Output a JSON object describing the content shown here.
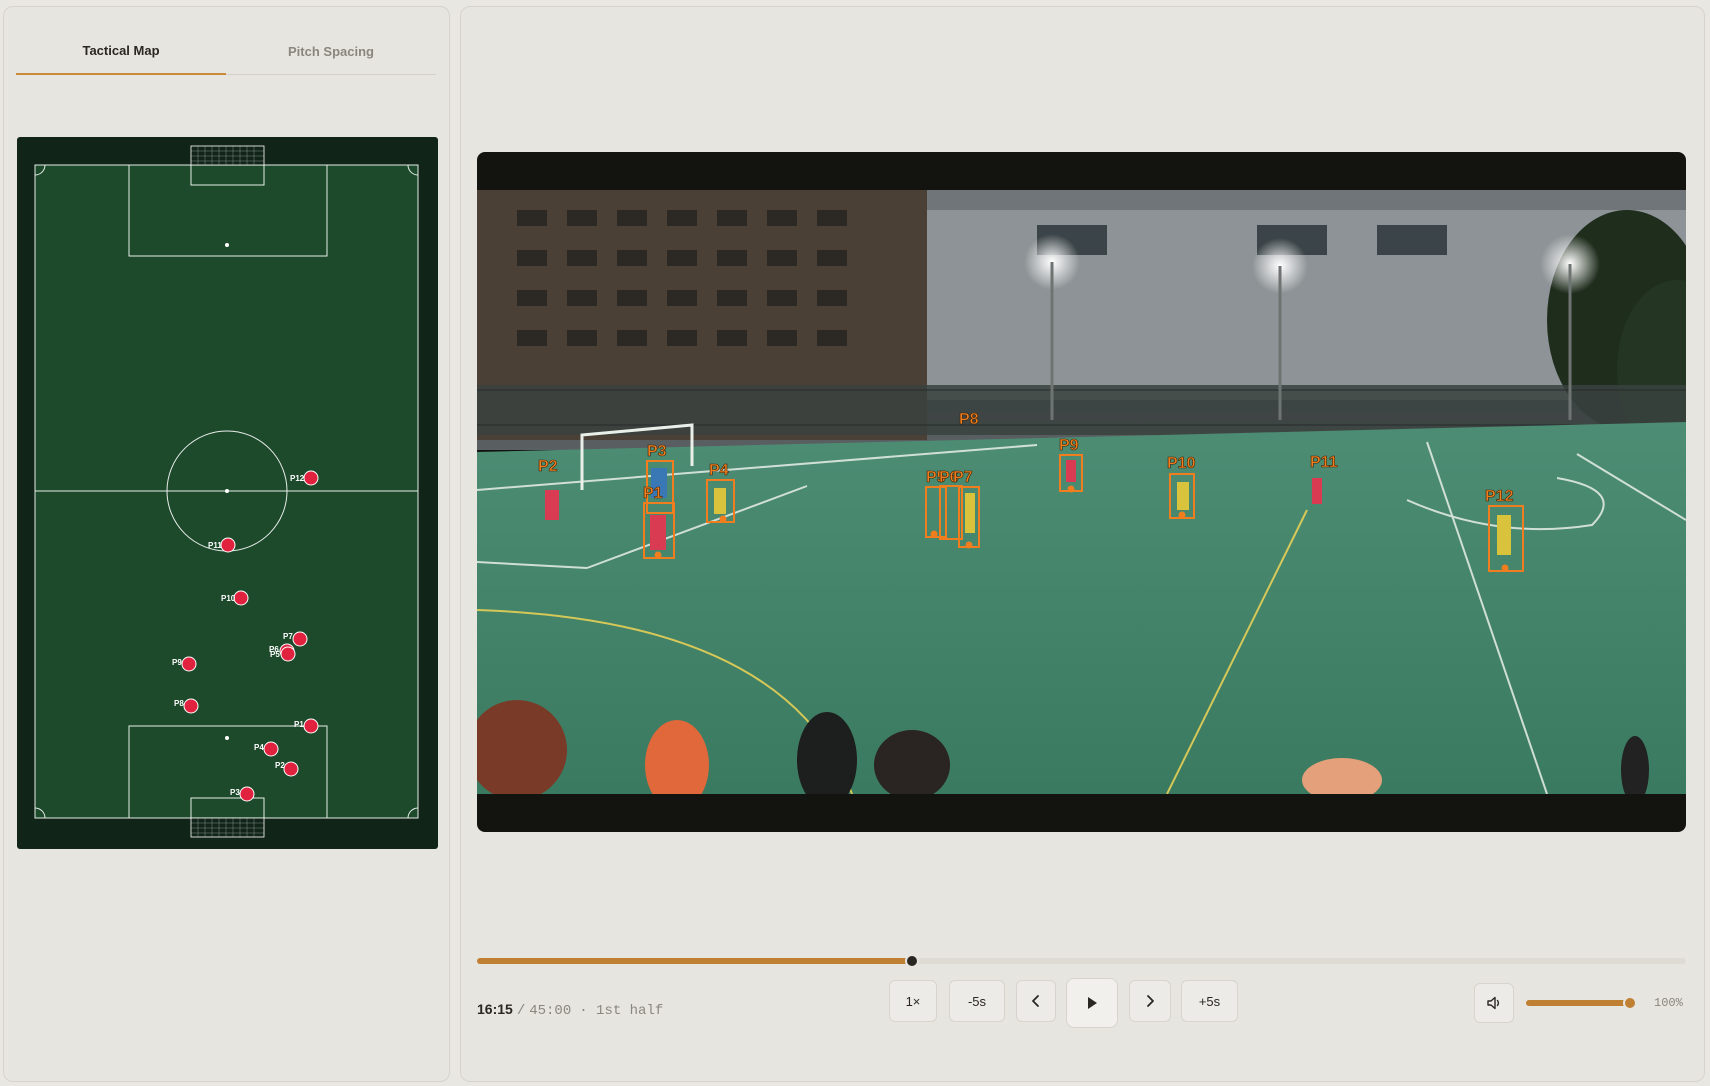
{
  "tabs": [
    {
      "label": "Tactical Map",
      "active": true
    },
    {
      "label": "Pitch Spacing",
      "active": false
    }
  ],
  "tactical_map": {
    "players": [
      {
        "id": "P12",
        "label": "P12"
      },
      {
        "id": "P11",
        "label": "P11"
      },
      {
        "id": "P10",
        "label": "P10"
      },
      {
        "id": "P7",
        "label": "P7"
      },
      {
        "id": "P6",
        "label": "P6"
      },
      {
        "id": "P5",
        "label": "P5"
      },
      {
        "id": "P9",
        "label": "P9"
      },
      {
        "id": "P8",
        "label": "P8"
      },
      {
        "id": "P1",
        "label": "P1"
      },
      {
        "id": "P4",
        "label": "P4"
      },
      {
        "id": "P2",
        "label": "P2"
      },
      {
        "id": "P3",
        "label": "P3"
      }
    ],
    "colors": {
      "pitch": "#1d4a2b",
      "player": "#e0223f",
      "lines": "#ffffff"
    }
  },
  "video": {
    "detections": [
      "P2",
      "P3",
      "P1",
      "P4",
      "P5",
      "P6",
      "P7",
      "P8",
      "P9",
      "P10",
      "P11",
      "P12"
    ],
    "box_color": "#f07d1e"
  },
  "playback": {
    "current_time": "16:15",
    "total_time": "45:00",
    "period": "· 1st half",
    "progress": 0.36,
    "speed_label": "1×",
    "back_label": "-5s",
    "forward_label": "+5s",
    "volume_label": "100%",
    "volume": 1.0,
    "icons": {
      "prev": "chevron-left-icon",
      "play": "play-icon",
      "next": "chevron-right-icon",
      "volume": "speaker-icon"
    }
  }
}
